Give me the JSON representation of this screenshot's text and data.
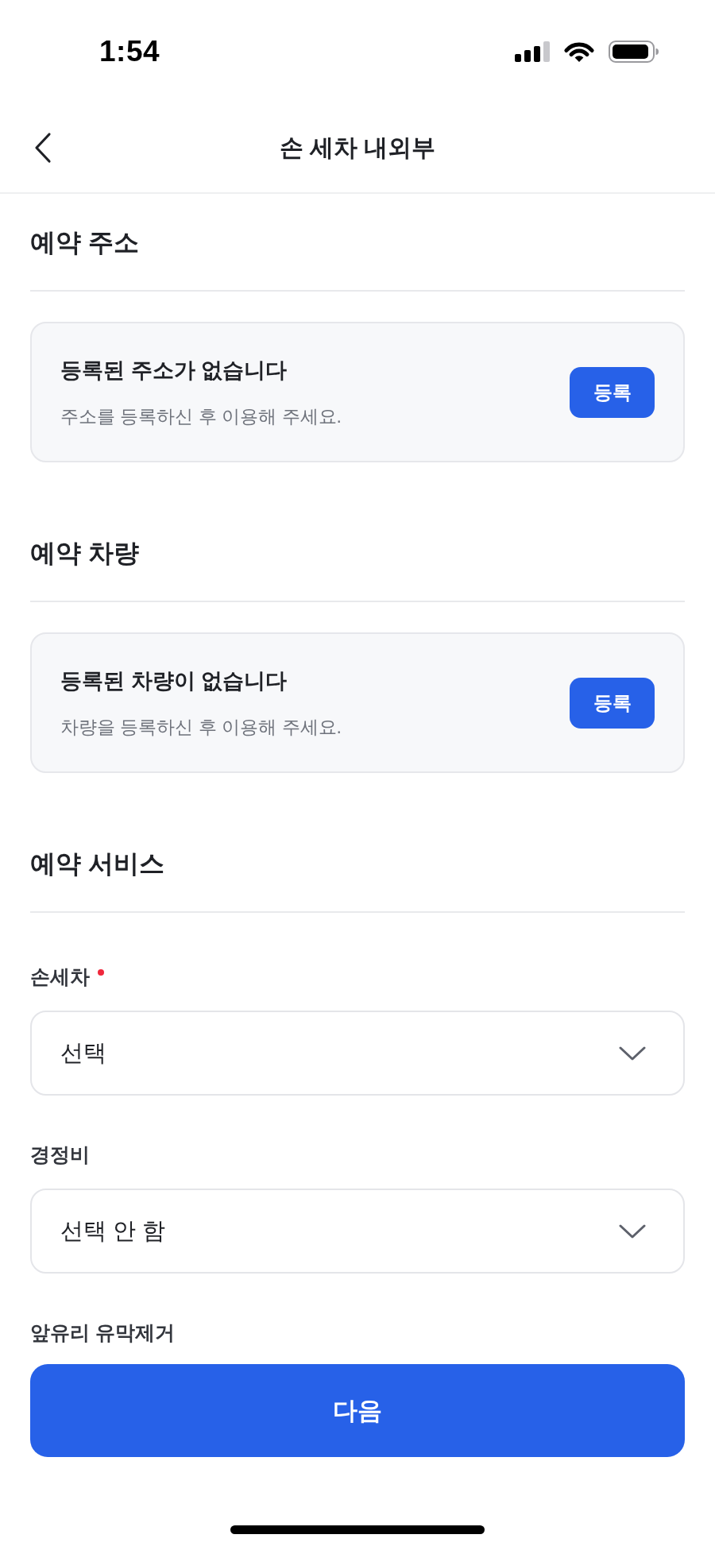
{
  "status_bar": {
    "time": "1:54"
  },
  "header": {
    "title": "손 세차 내외부"
  },
  "sections": [
    {
      "kind": "card",
      "title": "예약 주소",
      "card": {
        "title": "등록된 주소가 없습니다",
        "description": "주소를 등록하신 후 이용해 주세요.",
        "button": "등록"
      }
    },
    {
      "kind": "card",
      "title": "예약 차량",
      "card": {
        "title": "등록된 차량이 없습니다",
        "description": "차량을 등록하신 후 이용해 주세요.",
        "button": "등록"
      }
    },
    {
      "kind": "form",
      "title": "예약 서비스",
      "fields": [
        {
          "kind": "select",
          "label": "손세차",
          "required": true,
          "value": "선택"
        },
        {
          "kind": "select",
          "label": "경정비",
          "required": false,
          "value": "선택 안 함"
        },
        {
          "kind": "label",
          "label": "앞유리 유막제거",
          "required": false
        }
      ]
    }
  ],
  "next_button": {
    "label": "다음"
  }
}
